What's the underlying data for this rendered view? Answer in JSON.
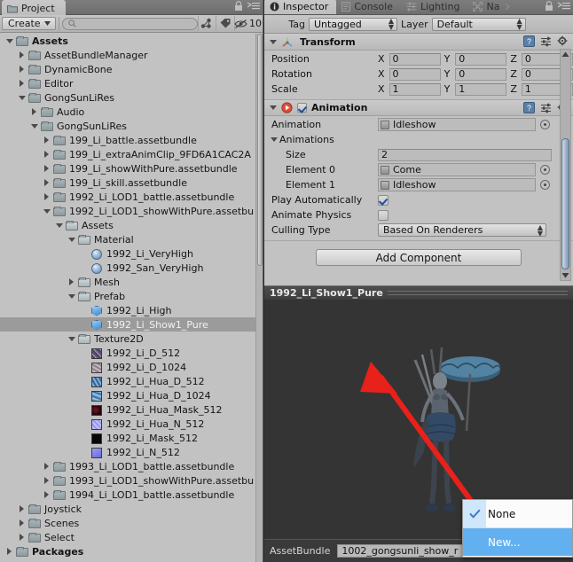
{
  "project": {
    "tab_label": "Project",
    "tab_icon": "folder-icon",
    "lock_icon": "lock-icon",
    "menu_icon": "context-menu-icon",
    "toolbar": {
      "create_label": "Create",
      "create_arrow": "chevron-down-icon",
      "search_placeholder": "",
      "search_value": "",
      "search_icon": "search-icon",
      "filter_type_icon": "filter-by-type-icon",
      "filter_label_icon": "filter-by-label-icon",
      "visibility_icon": "hidden-eye-icon",
      "visibility_count": "10"
    },
    "tree": [
      {
        "label": "Assets",
        "depth": 0,
        "icon": "folder-icon",
        "state": "open",
        "bold": true,
        "selected": false
      },
      {
        "label": "AssetBundleManager",
        "depth": 1,
        "icon": "folder-icon",
        "state": "closed",
        "bold": false,
        "selected": false
      },
      {
        "label": "DynamicBone",
        "depth": 1,
        "icon": "folder-icon",
        "state": "closed",
        "bold": false,
        "selected": false
      },
      {
        "label": "Editor",
        "depth": 1,
        "icon": "folder-icon",
        "state": "closed",
        "bold": false,
        "selected": false
      },
      {
        "label": "GongSunLiRes",
        "depth": 1,
        "icon": "folder-icon",
        "state": "open",
        "bold": false,
        "selected": false
      },
      {
        "label": "Audio",
        "depth": 2,
        "icon": "folder-icon",
        "state": "closed",
        "bold": false,
        "selected": false
      },
      {
        "label": "GongSunLiRes",
        "depth": 2,
        "icon": "folder-icon",
        "state": "open",
        "bold": false,
        "selected": false
      },
      {
        "label": "199_Li_battle.assetbundle",
        "depth": 3,
        "icon": "folder-icon",
        "state": "closed",
        "bold": false,
        "selected": false
      },
      {
        "label": "199_Li_extraAnimClip_9FD6A1CAC2A",
        "depth": 3,
        "icon": "folder-icon",
        "state": "closed",
        "bold": false,
        "selected": false
      },
      {
        "label": "199_Li_showWithPure.assetbundle",
        "depth": 3,
        "icon": "folder-icon",
        "state": "closed",
        "bold": false,
        "selected": false
      },
      {
        "label": "199_Li_skill.assetbundle",
        "depth": 3,
        "icon": "folder-icon",
        "state": "closed",
        "bold": false,
        "selected": false
      },
      {
        "label": "1992_Li_LOD1_battle.assetbundle",
        "depth": 3,
        "icon": "folder-icon",
        "state": "closed",
        "bold": false,
        "selected": false
      },
      {
        "label": "1992_Li_LOD1_showWithPure.assetbu",
        "depth": 3,
        "icon": "folder-icon",
        "state": "open",
        "bold": false,
        "selected": false
      },
      {
        "label": "Assets",
        "depth": 4,
        "icon": "folder-light-icon",
        "state": "open",
        "bold": false,
        "selected": false
      },
      {
        "label": "Material",
        "depth": 5,
        "icon": "folder-light-icon",
        "state": "open",
        "bold": false,
        "selected": false
      },
      {
        "label": "1992_Li_VeryHigh",
        "depth": 6,
        "icon": "material-sphere-icon",
        "state": "none",
        "bold": false,
        "selected": false
      },
      {
        "label": "1992_San_VeryHigh",
        "depth": 6,
        "icon": "material-sphere-icon",
        "state": "none",
        "bold": false,
        "selected": false
      },
      {
        "label": "Mesh",
        "depth": 5,
        "icon": "folder-light-icon",
        "state": "closed",
        "bold": false,
        "selected": false
      },
      {
        "label": "Prefab",
        "depth": 5,
        "icon": "folder-light-icon",
        "state": "open",
        "bold": false,
        "selected": false
      },
      {
        "label": "1992_Li_High",
        "depth": 6,
        "icon": "prefab-cube-icon",
        "state": "none",
        "bold": false,
        "selected": false
      },
      {
        "label": "1992_Li_Show1_Pure",
        "depth": 6,
        "icon": "prefab-cube-icon",
        "state": "none",
        "bold": false,
        "selected": true
      },
      {
        "label": "Texture2D",
        "depth": 5,
        "icon": "folder-light-icon",
        "state": "open",
        "bold": false,
        "selected": false
      },
      {
        "label": "1992_Li_D_512",
        "depth": 6,
        "icon": "texture-icon-1",
        "state": "none",
        "bold": false,
        "selected": false
      },
      {
        "label": "1992_Li_D_1024",
        "depth": 6,
        "icon": "texture-icon-2",
        "state": "none",
        "bold": false,
        "selected": false
      },
      {
        "label": "1992_Li_Hua_D_512",
        "depth": 6,
        "icon": "texture-icon-3",
        "state": "none",
        "bold": false,
        "selected": false
      },
      {
        "label": "1992_Li_Hua_D_1024",
        "depth": 6,
        "icon": "texture-icon-4",
        "state": "none",
        "bold": false,
        "selected": false
      },
      {
        "label": "1992_Li_Hua_Mask_512",
        "depth": 6,
        "icon": "texture-icon-5",
        "state": "none",
        "bold": false,
        "selected": false
      },
      {
        "label": "1992_Li_Hua_N_512",
        "depth": 6,
        "icon": "texture-icon-6",
        "state": "none",
        "bold": false,
        "selected": false
      },
      {
        "label": "1992_Li_Mask_512",
        "depth": 6,
        "icon": "texture-icon-7",
        "state": "none",
        "bold": false,
        "selected": false
      },
      {
        "label": "1992_Li_N_512",
        "depth": 6,
        "icon": "texture-icon-8",
        "state": "none",
        "bold": false,
        "selected": false
      },
      {
        "label": "1993_Li_LOD1_battle.assetbundle",
        "depth": 3,
        "icon": "folder-icon",
        "state": "closed",
        "bold": false,
        "selected": false
      },
      {
        "label": "1993_Li_LOD1_showWithPure.assetbu",
        "depth": 3,
        "icon": "folder-icon",
        "state": "closed",
        "bold": false,
        "selected": false
      },
      {
        "label": "1994_Li_LOD1_battle.assetbundle",
        "depth": 3,
        "icon": "folder-icon",
        "state": "closed",
        "bold": false,
        "selected": false
      },
      {
        "label": "Joystick",
        "depth": 1,
        "icon": "folder-icon",
        "state": "closed",
        "bold": false,
        "selected": false
      },
      {
        "label": "Scenes",
        "depth": 1,
        "icon": "folder-icon",
        "state": "closed",
        "bold": false,
        "selected": false
      },
      {
        "label": "Select",
        "depth": 1,
        "icon": "folder-icon",
        "state": "closed",
        "bold": false,
        "selected": false
      },
      {
        "label": "Packages",
        "depth": 0,
        "icon": "folder-icon",
        "state": "closed",
        "bold": true,
        "selected": false
      }
    ]
  },
  "inspector": {
    "tabs": [
      {
        "label": "Inspector",
        "icon": "info-icon",
        "active": true
      },
      {
        "label": "Console",
        "icon": "console-icon",
        "active": false
      },
      {
        "label": "Lighting",
        "icon": "lighting-icon",
        "active": false
      },
      {
        "label": "Na",
        "icon": "navigation-icon",
        "active": false
      }
    ],
    "lock_icon": "lock-icon",
    "menu_icon": "context-menu-icon",
    "tag_label": "Tag",
    "tag_value": "Untagged",
    "layer_label": "Layer",
    "layer_value": "Default",
    "transform": {
      "title": "Transform",
      "icon": "transform-icon",
      "help_icon": "help-icon",
      "preset_icon": "preset-icon",
      "gear_icon": "gear-icon",
      "rows": [
        {
          "label": "Position",
          "x": "0",
          "y": "0",
          "z": "0"
        },
        {
          "label": "Rotation",
          "x": "0",
          "y": "0",
          "z": "0"
        },
        {
          "label": "Scale",
          "x": "1",
          "y": "1",
          "z": "1"
        }
      ],
      "axis_x": "X",
      "axis_y": "Y",
      "axis_z": "Z"
    },
    "animation": {
      "title": "Animation",
      "icon": "animation-play-icon",
      "enabled": true,
      "help_icon": "help-icon",
      "preset_icon": "preset-icon",
      "gear_icon": "gear-icon",
      "animation_label": "Animation",
      "animation_value": "Idleshow",
      "animations_label": "Animations",
      "size_label": "Size",
      "size_value": "2",
      "elements": [
        {
          "label": "Element 0",
          "value": "Come"
        },
        {
          "label": "Element 1",
          "value": "Idleshow"
        }
      ],
      "play_auto_label": "Play Automatically",
      "play_auto_checked": true,
      "animate_physics_label": "Animate Physics",
      "animate_physics_checked": false,
      "culling_label": "Culling Type",
      "culling_value": "Based On Renderers"
    },
    "add_component_label": "Add Component"
  },
  "preview": {
    "title": "1992_Li_Show1_Pure",
    "assetbundle_label": "AssetBundle",
    "assetbundle_value": "1002_gongsunli_show_r",
    "annotation": "red-arrow-annotation"
  },
  "bundle_menu": {
    "items": [
      {
        "label": "None",
        "checked": true,
        "highlighted": false
      },
      {
        "label": "New...",
        "checked": false,
        "highlighted": true
      }
    ],
    "check_icon": "check-icon"
  },
  "colors": {
    "panel_bg": "#c2c2c2",
    "tab_bar": "#6e6e6e",
    "selection": "#9b9b9b",
    "menu_highlight": "#62b0f0",
    "annotation_red": "#e8211a",
    "preview_bg": "#343434"
  }
}
